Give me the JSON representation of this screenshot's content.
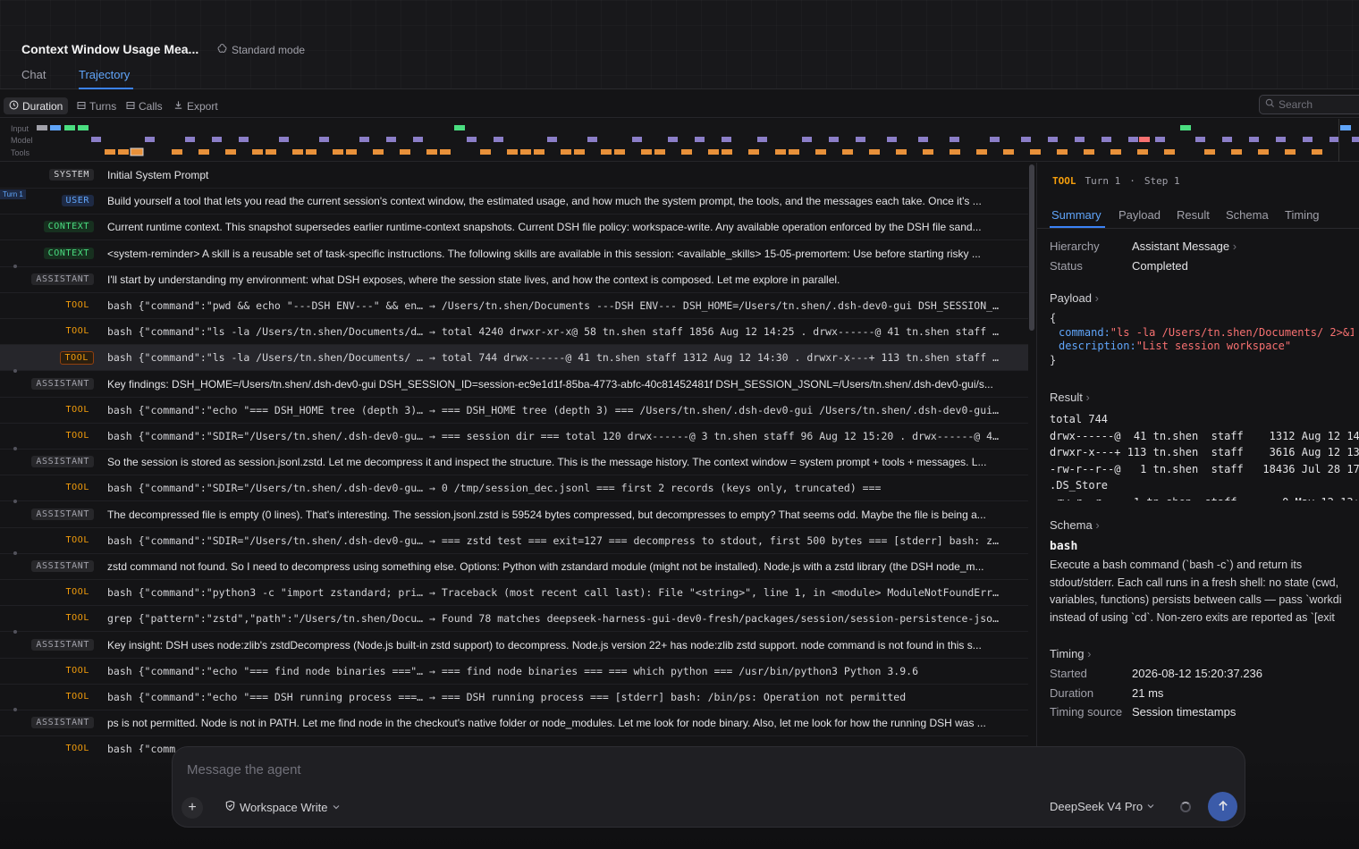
{
  "header": {
    "title": "Context Window Usage Mea...",
    "mode": "Standard mode",
    "tabs": [
      "Chat",
      "Trajectory"
    ]
  },
  "toolbar": {
    "duration": "Duration",
    "turns": "Turns",
    "calls": "Calls",
    "export": "Export",
    "search_placeholder": "Search"
  },
  "timeline": {
    "labels": [
      "Input",
      "Model",
      "Tools"
    ],
    "colors": {
      "input_gray": "#a1a1aa",
      "input_blue": "#60a5fa",
      "input_green": "#4ade80",
      "model": "#8b7ec8",
      "tool": "#e8913a",
      "error": "#f87171"
    }
  },
  "turn_marker": "Turn 1",
  "rows": [
    {
      "role": "SYSTEM",
      "text": "Initial System Prompt",
      "mono": false
    },
    {
      "role": "USER",
      "text": "Build yourself a tool that lets you read the current session's context window, the estimated usage, and how much the system prompt, the tools, and the messages each take. Once it's ...",
      "mono": false
    },
    {
      "role": "CONTEXT",
      "text": "Current runtime context. This snapshot supersedes earlier runtime-context snapshots. Current DSH file policy: workspace-write. Any available operation enforced by the DSH file sand...",
      "mono": false
    },
    {
      "role": "CONTEXT",
      "text": "<system-reminder> A skill is a reusable set of task-specific instructions. The following skills are available in this session: <available_skills> 15-05-premortem: Use before starting risky ...",
      "mono": false
    },
    {
      "role": "ASSISTANT",
      "text": "I'll start by understanding my environment: what DSH exposes, where the session state lives, and how the context is composed. Let me explore in parallel.",
      "mono": false
    },
    {
      "role": "TOOL",
      "text": "bash {\"command\":\"pwd && echo \"---DSH ENV---\" && en…  → /Users/tn.shen/Documents ---DSH ENV--- DSH_HOME=/Users/tn.shen/.dsh-dev0-gui DSH_SESSION_…",
      "mono": true
    },
    {
      "role": "TOOL",
      "text": "bash {\"command\":\"ls -la /Users/tn.shen/Documents/d…  → total 4240 drwxr-xr-x@ 58 tn.shen staff 1856 Aug 12 14:25 . drwx------@ 41 tn.shen staff …",
      "mono": true
    },
    {
      "role": "TOOL",
      "text": "bash {\"command\":\"ls -la /Users/tn.shen/Documents/ …  → total 744 drwx------@ 41 tn.shen staff 1312 Aug 12 14:30 . drwxr-x---+ 113 tn.shen staff …",
      "mono": true,
      "selected": true
    },
    {
      "role": "ASSISTANT",
      "text": "Key findings: DSH_HOME=/Users/tn.shen/.dsh-dev0-gui DSH_SESSION_ID=session-ec9e1d1f-85ba-4773-abfc-40c81452481f DSH_SESSION_JSONL=/Users/tn.shen/.dsh-dev0-gui/s...",
      "mono": false
    },
    {
      "role": "TOOL",
      "text": "bash {\"command\":\"echo \"=== DSH_HOME tree (depth 3)…  → === DSH_HOME tree (depth 3) === /Users/tn.shen/.dsh-dev0-gui /Users/tn.shen/.dsh-dev0-gui…",
      "mono": true
    },
    {
      "role": "TOOL",
      "text": "bash {\"command\":\"SDIR=\"/Users/tn.shen/.dsh-dev0-gu…  → === session dir === total 120 drwx------@ 3 tn.shen staff 96 Aug 12 15:20 . drwx------@ 4…",
      "mono": true
    },
    {
      "role": "ASSISTANT",
      "text": "So the session is stored as session.jsonl.zstd. Let me decompress it and inspect the structure. This is the message history. The context window = system prompt + tools + messages. L...",
      "mono": false
    },
    {
      "role": "TOOL",
      "text": "bash {\"command\":\"SDIR=\"/Users/tn.shen/.dsh-dev0-gu…  → 0 /tmp/session_dec.jsonl === first 2 records (keys only, truncated) ===",
      "mono": true
    },
    {
      "role": "ASSISTANT",
      "text": "The decompressed file is empty (0 lines). That's interesting. The session.jsonl.zstd is 59524 bytes compressed, but decompresses to empty? That seems odd. Maybe the file is being a...",
      "mono": false
    },
    {
      "role": "TOOL",
      "text": "bash {\"command\":\"SDIR=\"/Users/tn.shen/.dsh-dev0-gu…  → === zstd test === exit=127 === decompress to stdout, first 500 bytes === [stderr] bash: z…",
      "mono": true
    },
    {
      "role": "ASSISTANT",
      "text": "zstd command not found. So I need to decompress using something else. Options: Python with zstandard module (might not be installed). Node.js with a zstd library (the DSH node_m...",
      "mono": false
    },
    {
      "role": "TOOL",
      "text": "bash {\"command\":\"python3 -c \"import zstandard; pri…  → Traceback (most recent call last): File \"<string>\", line 1, in <module> ModuleNotFoundErr…",
      "mono": true
    },
    {
      "role": "TOOL",
      "text": "grep {\"pattern\":\"zstd\",\"path\":\"/Users/tn.shen/Docu…  → Found 78 matches deepseek-harness-gui-dev0-fresh/packages/session/session-persistence-jso…",
      "mono": true
    },
    {
      "role": "ASSISTANT",
      "text": "Key insight: DSH uses node:zlib's zstdDecompress (Node.js built-in zstd support) to decompress. Node.js version 22+ has node:zlib zstd support. node command is not found in this s...",
      "mono": false
    },
    {
      "role": "TOOL",
      "text": "bash {\"command\":\"echo \"=== find node binaries ===\"…  → === find node binaries === === which python === /usr/bin/python3 Python 3.9.6",
      "mono": true
    },
    {
      "role": "TOOL",
      "text": "bash {\"command\":\"echo \"=== DSH running process ===…  → === DSH running process === [stderr] bash: /bin/ps: Operation not permitted",
      "mono": true
    },
    {
      "role": "ASSISTANT",
      "text": "ps is not permitted. Node is not in PATH. Let me find node in the checkout's native folder or node_modules. Let me look for node binary. Also, let me look for how the running DSH was ...",
      "mono": false
    },
    {
      "role": "TOOL",
      "text": "bash {\"comm",
      "mono": true
    }
  ],
  "side": {
    "kind": "TOOL",
    "turn": "Turn 1",
    "step": "Step 1",
    "tabs": [
      "Summary",
      "Payload",
      "Result",
      "Schema",
      "Timing"
    ],
    "hierarchy_label": "Hierarchy",
    "hierarchy_value": "Assistant Message",
    "status_label": "Status",
    "status_value": "Completed",
    "payload_title": "Payload",
    "payload_open": "{",
    "payload_close": "}",
    "payload_command_key": "command:",
    "payload_command_val": "\"ls -la /Users/tn.shen/Documents/ 2>&1",
    "payload_desc_key": "description:",
    "payload_desc_val": "\"List session workspace\"",
    "result_title": "Result",
    "result_lines": [
      "total 744",
      "drwx------@  41 tn.shen  staff    1312 Aug 12 14:",
      "drwxr-x---+ 113 tn.shen  staff    3616 Aug 12 13:",
      "-rw-r--r--@   1 tn.shen  staff   18436 Jul 28 17:",
      ".DS_Store",
      "-rw-r--r--   1 tn.shen  staff       0 May 12 13:"
    ],
    "schema_title": "Schema",
    "schema_name": "bash",
    "schema_desc": [
      "Execute a bash command (`bash -c`) and return its",
      "stdout/stderr. Each call runs in a fresh shell: no state (cwd,",
      "variables, functions) persists between calls — pass `workdi",
      "instead of using `cd`. Non-zero exits are reported as `[exit"
    ],
    "timing_title": "Timing",
    "started_label": "Started",
    "started_value": "2026-08-12 15:20:37.236",
    "duration_label": "Duration",
    "duration_value": "21 ms",
    "source_label": "Timing source",
    "source_value": "Session timestamps"
  },
  "composer": {
    "placeholder": "Message the agent",
    "workspace": "Workspace Write",
    "model": "DeepSeek V4 Pro"
  }
}
